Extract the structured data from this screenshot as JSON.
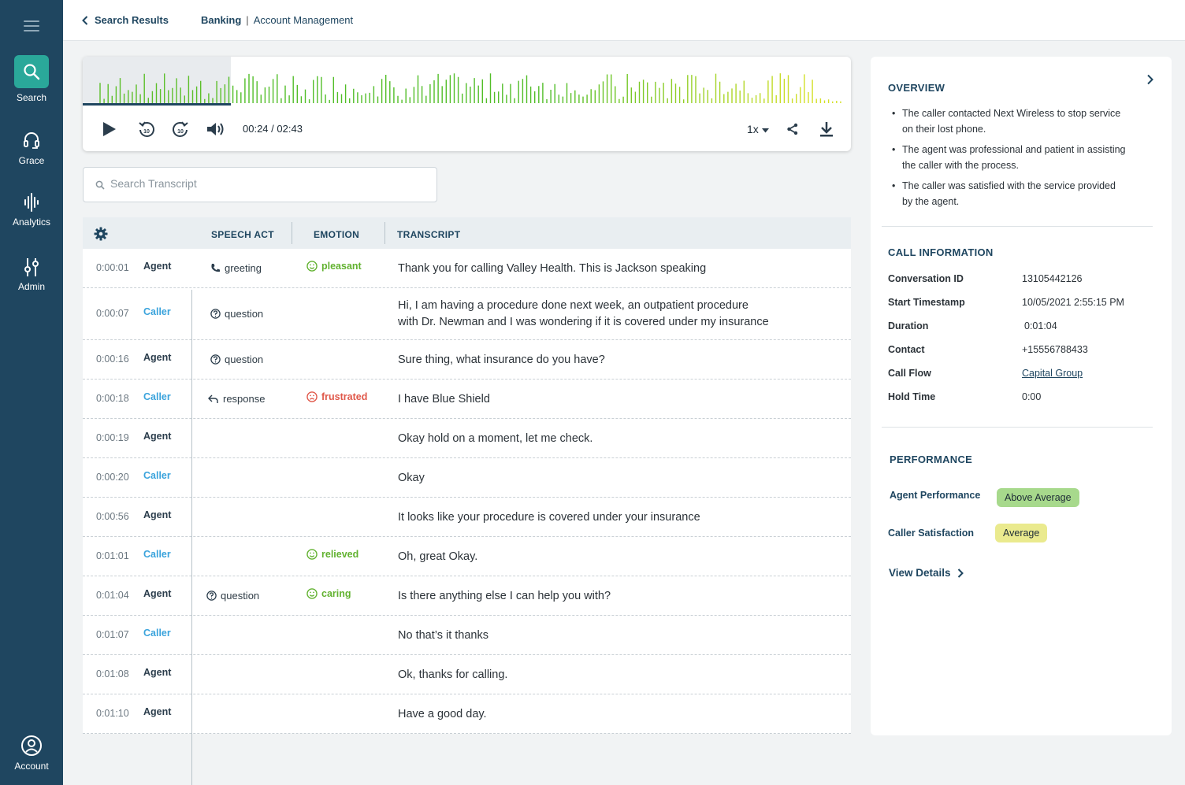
{
  "sidebar": {
    "items": [
      {
        "label": "Search"
      },
      {
        "label": "Grace"
      },
      {
        "label": "Analytics"
      },
      {
        "label": "Admin"
      }
    ],
    "account_label": "Account",
    "active_color": "#2aa89a"
  },
  "header": {
    "back_label": "Search Results",
    "crumb_primary": "Banking",
    "crumb_separator": "|",
    "crumb_secondary": "Account Management"
  },
  "player": {
    "current_time": "00:24 /",
    "total_time": "02:43",
    "speed": "1x",
    "played_fraction": 0.19,
    "icons": [
      "play-icon",
      "rewind-10-icon",
      "forward-10-icon",
      "volume-icon",
      "share-icon",
      "download-icon"
    ]
  },
  "transcript_search": {
    "placeholder": "Search Transcript"
  },
  "table": {
    "headers": {
      "speech_act": "SPEECH ACT",
      "emotion": "EMOTION",
      "transcript": "TRANSCRIPT"
    },
    "rows": [
      {
        "time": "0:00:01",
        "speaker": "Agent",
        "act": "greeting",
        "act_icon": "phone-icon",
        "emotion": "pleasant",
        "emotion_type": "good",
        "text": "Thank you for calling Valley Health. This is Jackson speaking"
      },
      {
        "time": "0:00:07",
        "speaker": "Caller",
        "act": "question",
        "act_icon": "question-icon",
        "emotion": "",
        "emotion_type": "",
        "text": "Hi, I am having a procedure done next week, an outpatient procedure",
        "text2": "with Dr. Newman and I was wondering if it is covered under my insurance"
      },
      {
        "time": "0:00:16",
        "speaker": "Agent",
        "act": "question",
        "act_icon": "question-icon",
        "emotion": "",
        "emotion_type": "",
        "text": "Sure thing, what insurance do you have?"
      },
      {
        "time": "0:00:18",
        "speaker": "Caller",
        "act": "response",
        "act_icon": "reply-icon",
        "emotion": "frustrated",
        "emotion_type": "bad",
        "text": "I have Blue Shield"
      },
      {
        "time": "0:00:19",
        "speaker": "Agent",
        "act": "",
        "act_icon": "",
        "emotion": "",
        "emotion_type": "",
        "text": "Okay hold on a moment, let me check."
      },
      {
        "time": "0:00:20",
        "speaker": "Caller",
        "act": "",
        "act_icon": "",
        "emotion": "",
        "emotion_type": "",
        "text": "Okay"
      },
      {
        "time": "0:00:56",
        "speaker": "Agent",
        "act": "",
        "act_icon": "",
        "emotion": "",
        "emotion_type": "",
        "text": "It looks like your procedure is covered under your insurance"
      },
      {
        "time": "0:01:01",
        "speaker": "Caller",
        "act": "",
        "act_icon": "",
        "emotion": "relieved",
        "emotion_type": "good",
        "text": "Oh, great Okay."
      },
      {
        "time": "0:01:04",
        "speaker": "Agent",
        "act": "question",
        "act_icon": "question-icon",
        "emotion": "caring",
        "emotion_type": "good",
        "text": "Is there anything else I can help you with?"
      },
      {
        "time": "0:01:07",
        "speaker": "Caller",
        "act": "",
        "act_icon": "",
        "emotion": "",
        "emotion_type": "",
        "text": "No that’s it thanks"
      },
      {
        "time": "0:01:08",
        "speaker": "Agent",
        "act": "",
        "act_icon": "",
        "emotion": "",
        "emotion_type": "",
        "text": "Ok, thanks for calling."
      },
      {
        "time": "0:01:10",
        "speaker": "Agent",
        "act": "",
        "act_icon": "",
        "emotion": "",
        "emotion_type": "",
        "text": "Have a good day."
      }
    ]
  },
  "overview": {
    "title": "OVERVIEW",
    "bullets": [
      {
        "l1": "The caller contacted Next Wireless to stop service",
        "l2": "on their lost phone."
      },
      {
        "l1": "The agent was professional and patient in assisting",
        "l2": "the caller with the process."
      },
      {
        "l1": "The caller was satisfied with the service provided",
        "l2": "by the agent."
      }
    ]
  },
  "call_info": {
    "title": "CALL INFORMATION",
    "rows": [
      {
        "key": "Conversation ID",
        "value": "13105442126"
      },
      {
        "key": "Start Timestamp",
        "value": "10/05/2021 2:55:15 PM"
      },
      {
        "key": "Duration",
        "value": "0:01:04"
      },
      {
        "key": "Contact",
        "value": "+15556788433"
      },
      {
        "key": "Call Flow",
        "value": "Capital Group"
      },
      {
        "key": "Hold Time",
        "value": "0:00"
      }
    ]
  },
  "performance": {
    "title": "PERFORMANCE",
    "agent_label": "Agent Performance",
    "agent_value": "Above Average",
    "caller_label": "Caller Satisfaction",
    "caller_value": "Average",
    "view_details": "View Details",
    "colors": {
      "above_average": "#a7d98c",
      "average": "#eaea8e"
    }
  }
}
